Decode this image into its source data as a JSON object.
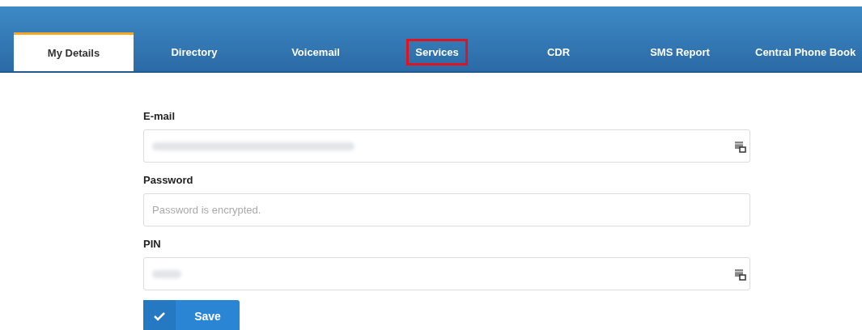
{
  "tabs": [
    {
      "label": "My Details",
      "selected": true,
      "highlighted": false
    },
    {
      "label": "Directory",
      "selected": false,
      "highlighted": false
    },
    {
      "label": "Voicemail",
      "selected": false,
      "highlighted": false
    },
    {
      "label": "Services",
      "selected": false,
      "highlighted": true
    },
    {
      "label": "CDR",
      "selected": false,
      "highlighted": false
    },
    {
      "label": "SMS Report",
      "selected": false,
      "highlighted": false
    },
    {
      "label": "Central Phone Book",
      "selected": false,
      "highlighted": false
    }
  ],
  "fields": [
    {
      "label": "E-mail",
      "kind": "redacted",
      "icon": true
    },
    {
      "label": "Password",
      "kind": "placeholder",
      "placeholder": "Password is encrypted.",
      "icon": false
    },
    {
      "label": "PIN",
      "kind": "redacted-short",
      "icon": true
    }
  ],
  "save_button": {
    "label": "Save"
  }
}
